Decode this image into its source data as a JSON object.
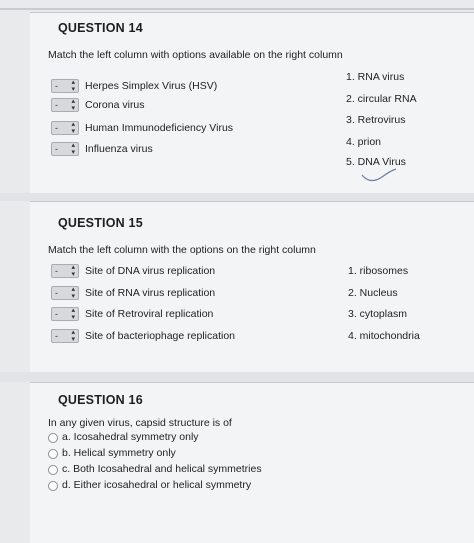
{
  "q14": {
    "title": "QUESTION 14",
    "prompt": "Match the left column with options available on the right column",
    "items": [
      {
        "select": "-",
        "label": "Herpes Simplex Virus (HSV)"
      },
      {
        "select": "-",
        "label": "Corona virus"
      },
      {
        "select": "-",
        "label": "Human Immunodeficiency Virus"
      },
      {
        "select": "-",
        "label": "Influenza virus"
      }
    ],
    "options": [
      "1. RNA virus",
      "2. circular RNA",
      "3. Retrovirus",
      "4. prion",
      "5. DNA Virus"
    ]
  },
  "q15": {
    "title": "QUESTION 15",
    "prompt": "Match the left column with the options on the right column",
    "items": [
      {
        "select": "-",
        "label": "Site of DNA virus replication"
      },
      {
        "select": "-",
        "label": "Site of RNA virus replication"
      },
      {
        "select": "-",
        "label": "Site of Retroviral replication"
      },
      {
        "select": "-",
        "label": "Site of bacteriophage replication"
      }
    ],
    "options": [
      "1. ribosomes",
      "2. Nucleus",
      "3. cytoplasm",
      "4. mitochondria"
    ]
  },
  "q16": {
    "title": "QUESTION 16",
    "prompt": "In any given virus, capsid structure is of",
    "choices": [
      "a. Icosahedral symmetry only",
      "b. Helical symmetry only",
      "c. Both Icosahedral and helical symmetries",
      "d. Either icosahedral or helical symmetry"
    ]
  }
}
